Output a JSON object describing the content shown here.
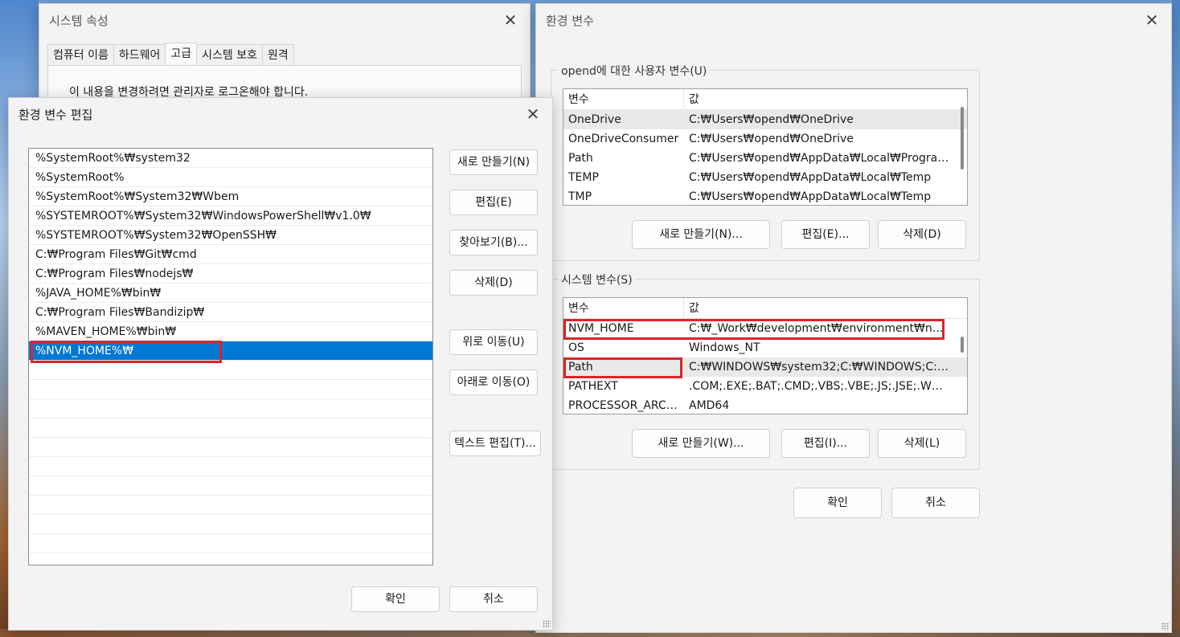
{
  "system_properties": {
    "title": "시스템 속성",
    "tabs": [
      "컴퓨터 이름",
      "하드웨어",
      "고급",
      "시스템 보호",
      "원격"
    ],
    "active_tab": "고급",
    "notice": "이 내용을 변경하려면 관리자로 로그온해야 합니다."
  },
  "env_vars": {
    "title": "환경 변수",
    "user_group_label": "opend에 대한 사용자 변수(U)",
    "system_group_label": "시스템 변수(S)",
    "col_var": "변수",
    "col_value": "값",
    "user_vars": [
      {
        "name": "OneDrive",
        "value": "C:₩Users₩opend₩OneDrive"
      },
      {
        "name": "OneDriveConsumer",
        "value": "C:₩Users₩opend₩OneDrive"
      },
      {
        "name": "Path",
        "value": "C:₩Users₩opend₩AppData₩Local₩Programs..."
      },
      {
        "name": "TEMP",
        "value": "C:₩Users₩opend₩AppData₩Local₩Temp"
      },
      {
        "name": "TMP",
        "value": "C:₩Users₩opend₩AppData₩Local₩Temp"
      }
    ],
    "system_vars": [
      {
        "name": "NVM_HOME",
        "value": "C:₩_Work₩development₩environment₩nvm..."
      },
      {
        "name": "OS",
        "value": "Windows_NT"
      },
      {
        "name": "Path",
        "value": "C:₩WINDOWS₩system32;C:₩WINDOWS;C:₩..."
      },
      {
        "name": "PATHEXT",
        "value": ".COM;.EXE;.BAT;.CMD;.VBS;.VBE;.JS;.JSE;.WSF;..."
      },
      {
        "name": "PROCESSOR_ARCH...",
        "value": "AMD64"
      }
    ],
    "user_buttons": {
      "new": "새로 만들기(N)...",
      "edit": "편집(E)...",
      "delete": "삭제(D)"
    },
    "system_buttons": {
      "new": "새로 만들기(W)...",
      "edit": "편집(I)...",
      "delete": "삭제(L)"
    },
    "ok": "확인",
    "cancel": "취소"
  },
  "edit_env": {
    "title": "환경 변수 편집",
    "entries": [
      "%SystemRoot%₩system32",
      "%SystemRoot%",
      "%SystemRoot%₩System32₩Wbem",
      "%SYSTEMROOT%₩System32₩WindowsPowerShell₩v1.0₩",
      "%SYSTEMROOT%₩System32₩OpenSSH₩",
      "C:₩Program Files₩Git₩cmd",
      "C:₩Program Files₩nodejs₩",
      "%JAVA_HOME%₩bin₩",
      "C:₩Program Files₩Bandizip₩",
      "%MAVEN_HOME%₩bin₩",
      "%NVM_HOME%₩"
    ],
    "selected_index": 10,
    "buttons": {
      "new": "새로 만들기(N)",
      "edit": "편집(E)",
      "browse": "찾아보기(B)...",
      "delete": "삭제(D)",
      "move_up": "위로 이동(U)",
      "move_down": "아래로 이동(O)",
      "edit_text": "텍스트 편집(T)..."
    },
    "ok": "확인",
    "cancel": "취소"
  },
  "colors": {
    "selection": "#0078d4",
    "highlight_box": "#d9262a"
  }
}
